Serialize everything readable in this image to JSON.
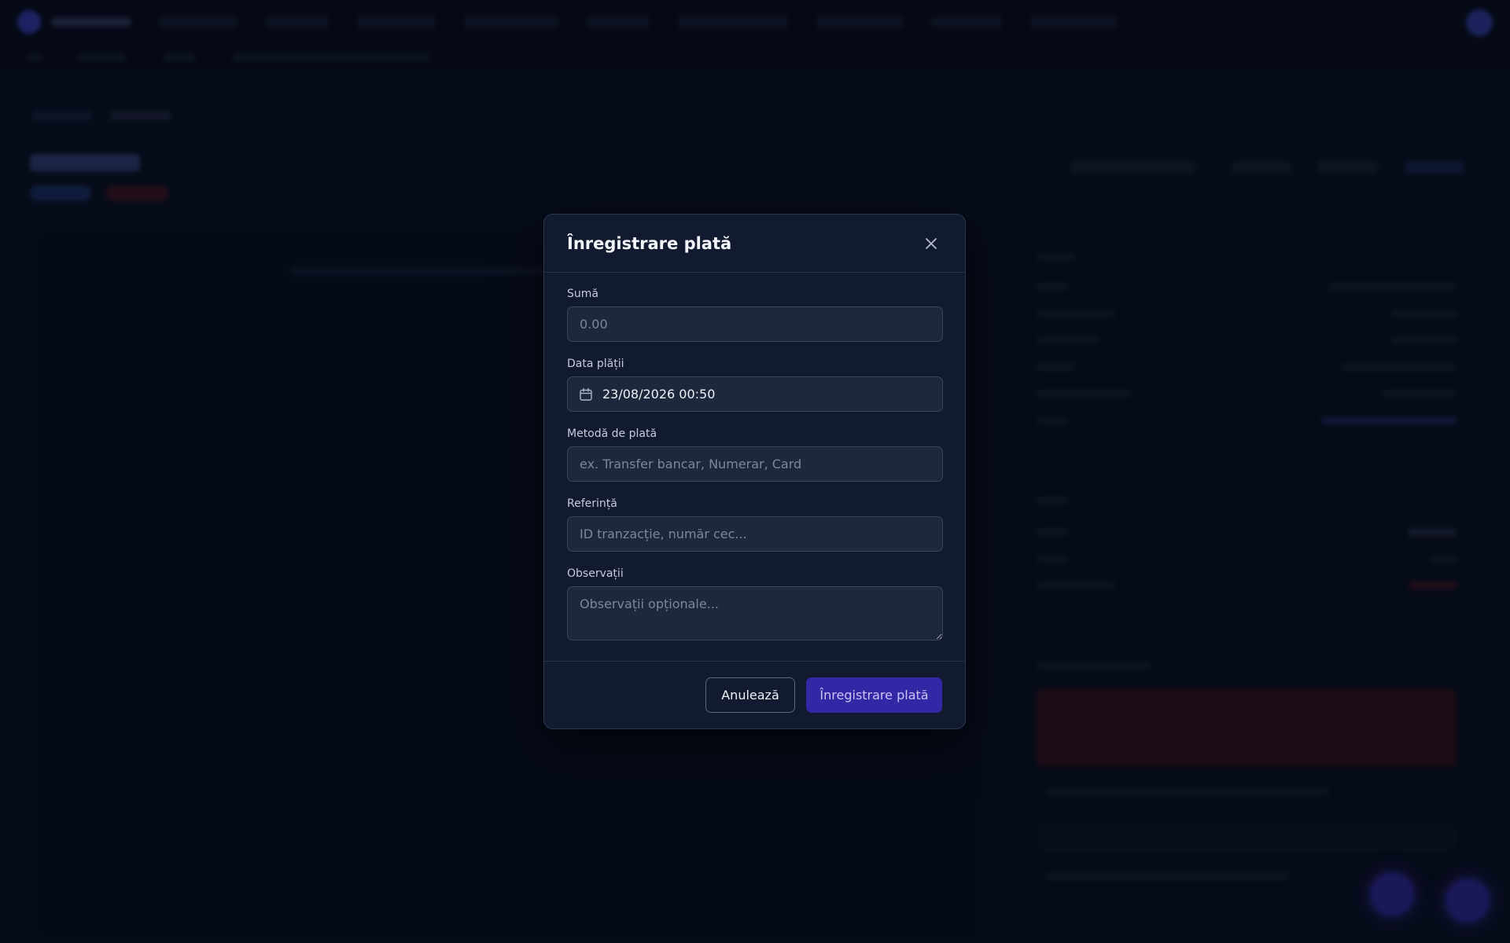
{
  "modal": {
    "title": "Înregistrare plată",
    "fields": {
      "amount": {
        "label": "Sumă",
        "placeholder": "0.00",
        "value": ""
      },
      "payment_date": {
        "label": "Data plății",
        "value": "23/08/2026 00:50"
      },
      "method": {
        "label": "Metodă de plată",
        "placeholder": "ex. Transfer bancar, Numerar, Card",
        "value": ""
      },
      "reference": {
        "label": "Referință",
        "placeholder": "ID tranzacție, număr cec...",
        "value": ""
      },
      "notes": {
        "label": "Observații",
        "placeholder": "Observații opționale...",
        "value": ""
      }
    },
    "buttons": {
      "cancel": "Anulează",
      "submit": "Înregistrare plată"
    }
  },
  "icons": {
    "close": "close-icon",
    "calendar": "calendar-icon"
  },
  "colors": {
    "accent": "#3427a6",
    "background": "#0d1424",
    "modal_bg": "#111a2e"
  }
}
